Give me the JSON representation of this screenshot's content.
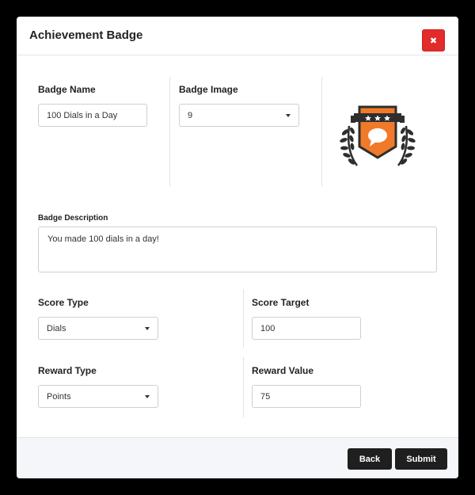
{
  "dialog": {
    "title": "Achievement Badge",
    "close_glyph": "✖"
  },
  "badge_name": {
    "label": "Badge Name",
    "value": "100 Dials in a Day"
  },
  "badge_image": {
    "label": "Badge Image",
    "value": "9",
    "preview_icon": "badge-speech-bubble-laurel-icon"
  },
  "badge_description": {
    "label": "Badge Description",
    "value": "You made 100 dials in a day!"
  },
  "score_type": {
    "label": "Score Type",
    "value": "Dials"
  },
  "score_target": {
    "label": "Score Target",
    "value": "100"
  },
  "reward_type": {
    "label": "Reward Type",
    "value": "Points"
  },
  "reward_value": {
    "label": "Reward Value",
    "value": "75"
  },
  "footer": {
    "back_label": "Back",
    "submit_label": "Submit"
  },
  "colors": {
    "close_button": "#e22b2b",
    "primary_button": "#1f1f1f",
    "badge_orange": "#f07a2a",
    "badge_dark": "#2e2e2e"
  }
}
